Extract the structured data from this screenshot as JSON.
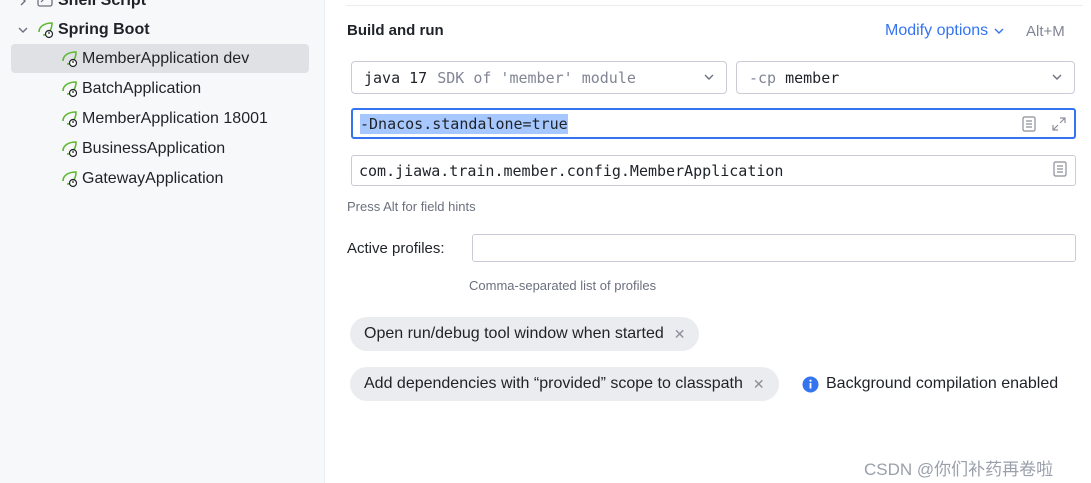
{
  "sidebar": {
    "items": [
      {
        "label": "Shell Script",
        "expanded": false
      },
      {
        "label": "Spring Boot",
        "expanded": true
      },
      {
        "label": "MemberApplication dev",
        "selected": true
      },
      {
        "label": "BatchApplication"
      },
      {
        "label": "MemberApplication 18001"
      },
      {
        "label": "BusinessApplication"
      },
      {
        "label": "GatewayApplication"
      }
    ]
  },
  "main": {
    "section_title": "Build and run",
    "modify_options": "Modify options",
    "modify_shortcut": "Alt+M",
    "jdk_dropdown": {
      "keyword": "java 17",
      "detail": "SDK of 'member' module"
    },
    "classpath_dropdown": {
      "flag": "-cp",
      "value": "member"
    },
    "vm_options": "-Dnacos.standalone=true",
    "main_class": "com.jiawa.train.member.config.MemberApplication",
    "field_hint": "Press Alt for field hints",
    "active_profiles_label": "Active profiles:",
    "active_profiles_value": "",
    "profiles_hint": "Comma-separated list of profiles",
    "chips": [
      {
        "label": "Open run/debug tool window when started"
      },
      {
        "label": "Add dependencies with “provided” scope to classpath"
      }
    ],
    "info_text": "Background compilation enabled"
  },
  "watermark": "CSDN @你们补药再卷啦",
  "colors": {
    "accent": "#3574f0",
    "selection": "#a6c8ff",
    "spring_green": "#5fb832"
  }
}
